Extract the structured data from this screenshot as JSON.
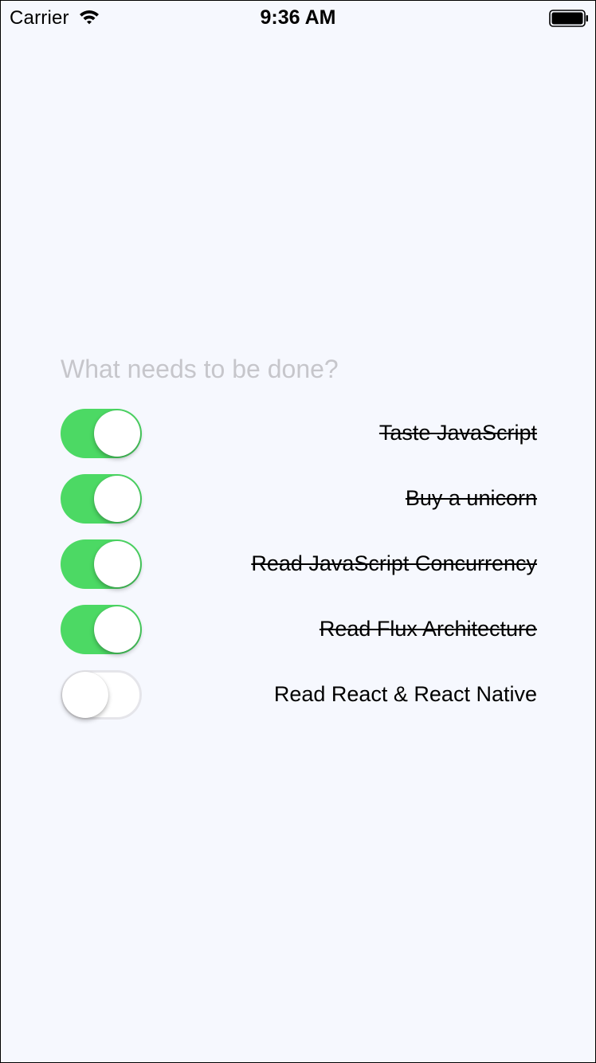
{
  "status_bar": {
    "carrier": "Carrier",
    "time": "9:36 AM",
    "icons": [
      "wifi-icon",
      "battery-icon"
    ]
  },
  "input": {
    "value": "",
    "placeholder": "What needs to be done?"
  },
  "todos": [
    {
      "text": "Taste JavaScript",
      "completed": true
    },
    {
      "text": "Buy a unicorn",
      "completed": true
    },
    {
      "text": "Read JavaScript Concurrency",
      "completed": true
    },
    {
      "text": "Read Flux Architecture",
      "completed": true
    },
    {
      "text": "Read React & React Native",
      "completed": false
    }
  ],
  "colors": {
    "background": "#f6f8fe",
    "switch_on": "#4cd964",
    "switch_off_border": "#e5e5ea",
    "placeholder": "#c6c6cb",
    "text": "#000000"
  }
}
